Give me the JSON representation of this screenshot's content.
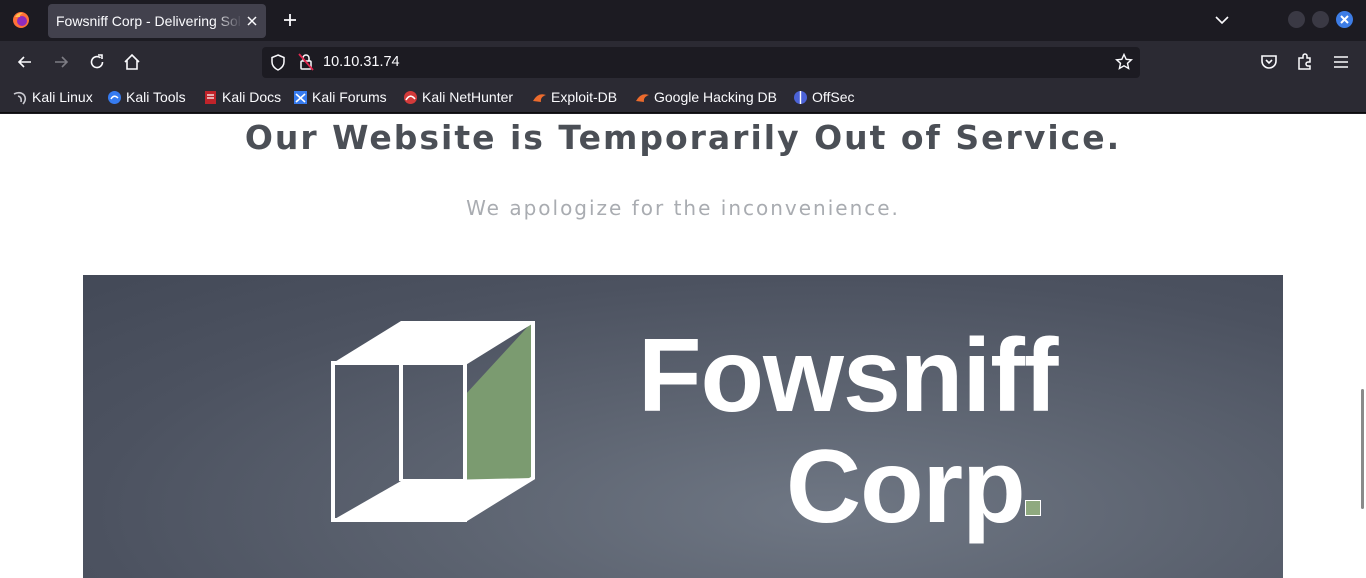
{
  "browser": {
    "tab": {
      "title": "Fowsniff Corp - Delivering Solutions"
    },
    "url": "10.10.31.74",
    "bookmarks": [
      {
        "label": "Kali Linux",
        "icon": "kali-dragon-icon"
      },
      {
        "label": "Kali Tools",
        "icon": "kali-tools-icon"
      },
      {
        "label": "Kali Docs",
        "icon": "kali-docs-icon"
      },
      {
        "label": "Kali Forums",
        "icon": "kali-forums-icon"
      },
      {
        "label": "Kali NetHunter",
        "icon": "nethunter-icon"
      },
      {
        "label": "Exploit-DB",
        "icon": "exploit-db-icon"
      },
      {
        "label": "Google Hacking DB",
        "icon": "ghdb-icon"
      },
      {
        "label": "OffSec",
        "icon": "offsec-icon"
      }
    ]
  },
  "page": {
    "headline": "Our Website is Temporarily Out of Service.",
    "subline": "We apologize for the inconvenience.",
    "banner": {
      "line1": "Fowsniff",
      "line2": "Corp"
    }
  },
  "colors": {
    "accent_green": "#8fa97f",
    "banner_bg": "#5d6471",
    "headline": "#4b4f56"
  }
}
